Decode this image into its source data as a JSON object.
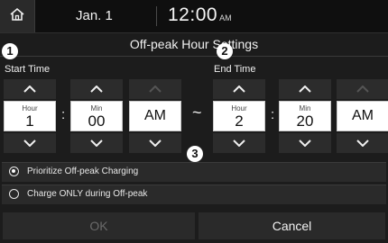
{
  "status_bar": {
    "date": "Jan.  1",
    "time": "12:00",
    "time_suffix": "AM"
  },
  "page": {
    "title": "Off-peak Hour Settings",
    "callouts": [
      "1",
      "2",
      "3"
    ]
  },
  "start_time": {
    "label": "Start Time",
    "hour_caption": "Hour",
    "hour": "1",
    "min_caption": "Min",
    "min": "00",
    "ampm": "AM"
  },
  "separator": {
    "colon": ":",
    "range": "~"
  },
  "end_time": {
    "label": "End Time",
    "hour_caption": "Hour",
    "hour": "2",
    "min_caption": "Min",
    "min": "20",
    "ampm": "AM"
  },
  "options": [
    {
      "label": "Prioritize Off-peak Charging",
      "selected": true
    },
    {
      "label": "Charge ONLY during Off-peak",
      "selected": false
    }
  ],
  "buttons": {
    "ok": "OK",
    "cancel": "Cancel"
  },
  "icons": {
    "home": "home-icon",
    "up": "chevron-up-icon",
    "down": "chevron-down-icon"
  },
  "colors": {
    "background": "#1c1c1c",
    "panel": "#2c2c2c",
    "value_box": "#ffffff",
    "text": "#f0f0f0",
    "disabled_text": "#6a6a6a"
  }
}
